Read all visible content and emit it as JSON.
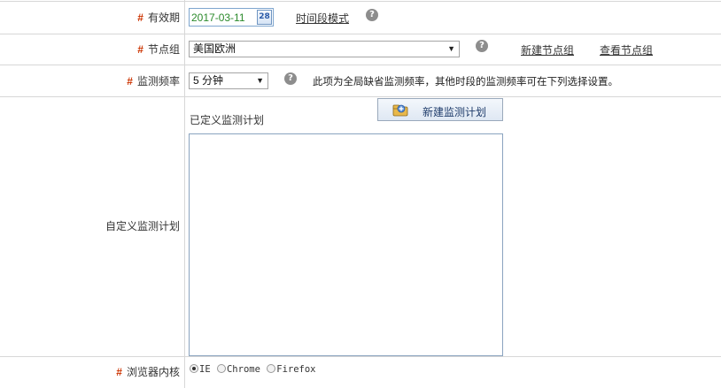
{
  "validity": {
    "label": "有效期",
    "date_value": "2017-03-11",
    "calendar_icon_text": "28",
    "mode_link": "时间段模式"
  },
  "node_group": {
    "label": "节点组",
    "selected": "美国欧洲",
    "new_link": "新建节点组",
    "view_link": "查看节点组"
  },
  "frequency": {
    "label": "监测频率",
    "selected": "5 分钟",
    "hint": "此项为全局缺省监测频率，其他时段的监测频率可在下列选择设置。"
  },
  "custom_plan": {
    "label": "自定义监测计划",
    "new_button": "新建监测计划",
    "defined_label": "已定义监测计划"
  },
  "browser": {
    "label": "浏览器内核",
    "options": [
      {
        "label": "IE",
        "checked": true
      },
      {
        "label": "Chrome",
        "checked": false
      },
      {
        "label": "Firefox",
        "checked": false
      }
    ]
  },
  "required_mark": "#",
  "help_glyph": "?",
  "dropdown_glyph": "▼",
  "colors": {
    "required": "#cc3300",
    "date_text": "#2b8a2b",
    "border": "#d7d7d7"
  }
}
